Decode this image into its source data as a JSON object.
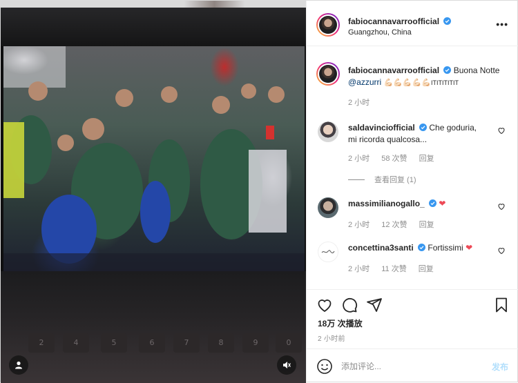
{
  "post": {
    "author": "fabiocannavarroofficial",
    "location": "Guangzhou, China",
    "more_label": "•••"
  },
  "caption": {
    "username": "fabiocannavarroofficial",
    "text": "Buona Notte",
    "mention": "@azzurri",
    "emoji": "💪🏻💪🏻💪🏻💪🏻💪🏻",
    "tail": "ITITITITIT",
    "time": "2 小时"
  },
  "comments": [
    {
      "username": "saldavinciofficial",
      "text": "Che goduria, mi ricorda qualcosa...",
      "time": "2 小时",
      "likes": "58 次赞",
      "reply": "回复",
      "view_replies": "查看回复 (1)"
    },
    {
      "username": "massimilianogallo_",
      "emoji": "❤",
      "time": "2 小时",
      "likes": "12 次赞",
      "reply": "回复"
    },
    {
      "username": "concettina3santi",
      "text": "Fortissimi",
      "emoji": "❤",
      "time": "2 小时",
      "likes": "11 次赞",
      "reply": "回复"
    }
  ],
  "actions": {
    "views": "18万 次播放",
    "posted": "2 小时前"
  },
  "add_comment": {
    "placeholder": "添加评论...",
    "post_label": "发布"
  },
  "keyboard": [
    "2",
    "4",
    "5",
    "6",
    "7",
    "8",
    "9",
    "0"
  ],
  "colors": {
    "accent": "#0095f6",
    "link": "#00376b",
    "like_red": "#ed4956",
    "muted": "#8e8e8e"
  },
  "icons": [
    "verified-badge-icon",
    "heart-icon",
    "comment-icon",
    "share-icon",
    "save-icon",
    "emoji-icon",
    "user-icon",
    "mute-icon",
    "more-icon"
  ]
}
